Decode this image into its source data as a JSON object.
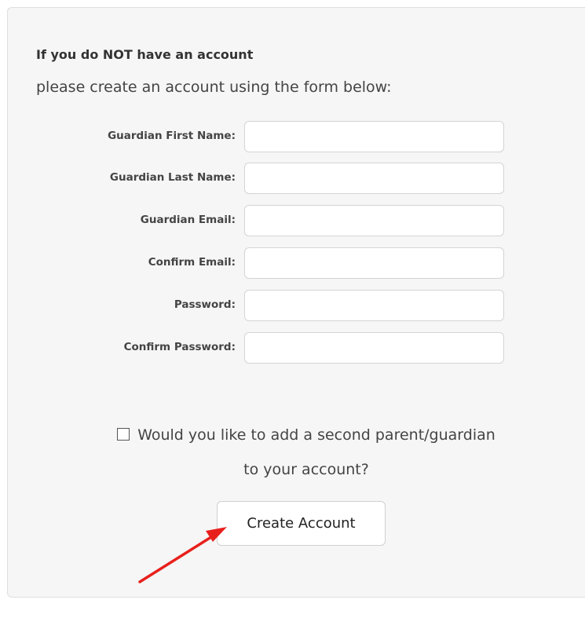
{
  "heading": "If you do NOT have an account",
  "subheading": "please create an account using the form below:",
  "fields": [
    {
      "label": "Guardian First Name:",
      "value": "",
      "placeholder": ""
    },
    {
      "label": "Guardian Last Name:",
      "value": "",
      "placeholder": ""
    },
    {
      "label": "Guardian Email:",
      "value": "",
      "placeholder": ""
    },
    {
      "label": "Confirm Email:",
      "value": "",
      "placeholder": ""
    },
    {
      "label": "Password:",
      "value": "",
      "placeholder": ""
    },
    {
      "label": "Confirm Password:",
      "value": "",
      "placeholder": ""
    }
  ],
  "second_guardian": {
    "line1": "Would you like to add a second parent/guardian",
    "line2": "to your account?",
    "checked": false
  },
  "create_button_label": "Create Account",
  "colors": {
    "panel_bg": "#f6f6f6",
    "annotation_arrow": "#e8201c"
  },
  "icons": {
    "annotation": "arrow-pointer-icon"
  }
}
